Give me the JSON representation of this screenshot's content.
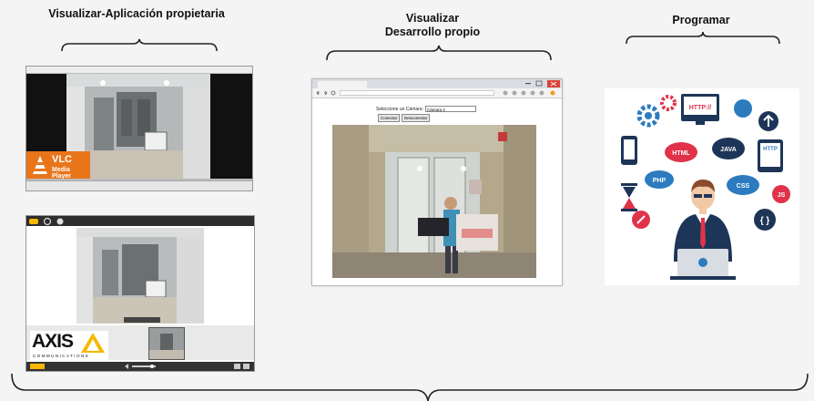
{
  "sections": {
    "app_title": "Visualizar-Aplicación propietaria",
    "dev_title_line1": "Visualizar",
    "dev_title_line2": "Desarrollo propio",
    "prog_title": "Programar"
  },
  "vlc": {
    "badge_line1": "VLC",
    "badge_line2": "Media Player"
  },
  "axis": {
    "logo_word": "AXIS",
    "logo_sub": "COMMUNICATIONS"
  },
  "browser": {
    "camera_select_label": "Seleccione un Cámara:",
    "camera_select_value": "Cámara 4",
    "connect_button": "Conectar",
    "disconnect_button": "Desconectar"
  },
  "programming": {
    "labels": [
      "HTTP://",
      "JAVA",
      "HTML",
      "PHP",
      "CSS",
      "HTTP",
      "JS"
    ]
  },
  "colors": {
    "vlc_orange": "#e9751b",
    "axis_yellow": "#f6b800",
    "prog_red": "#e0334a",
    "prog_navy": "#1d3557",
    "prog_blue": "#2c7bbf"
  }
}
